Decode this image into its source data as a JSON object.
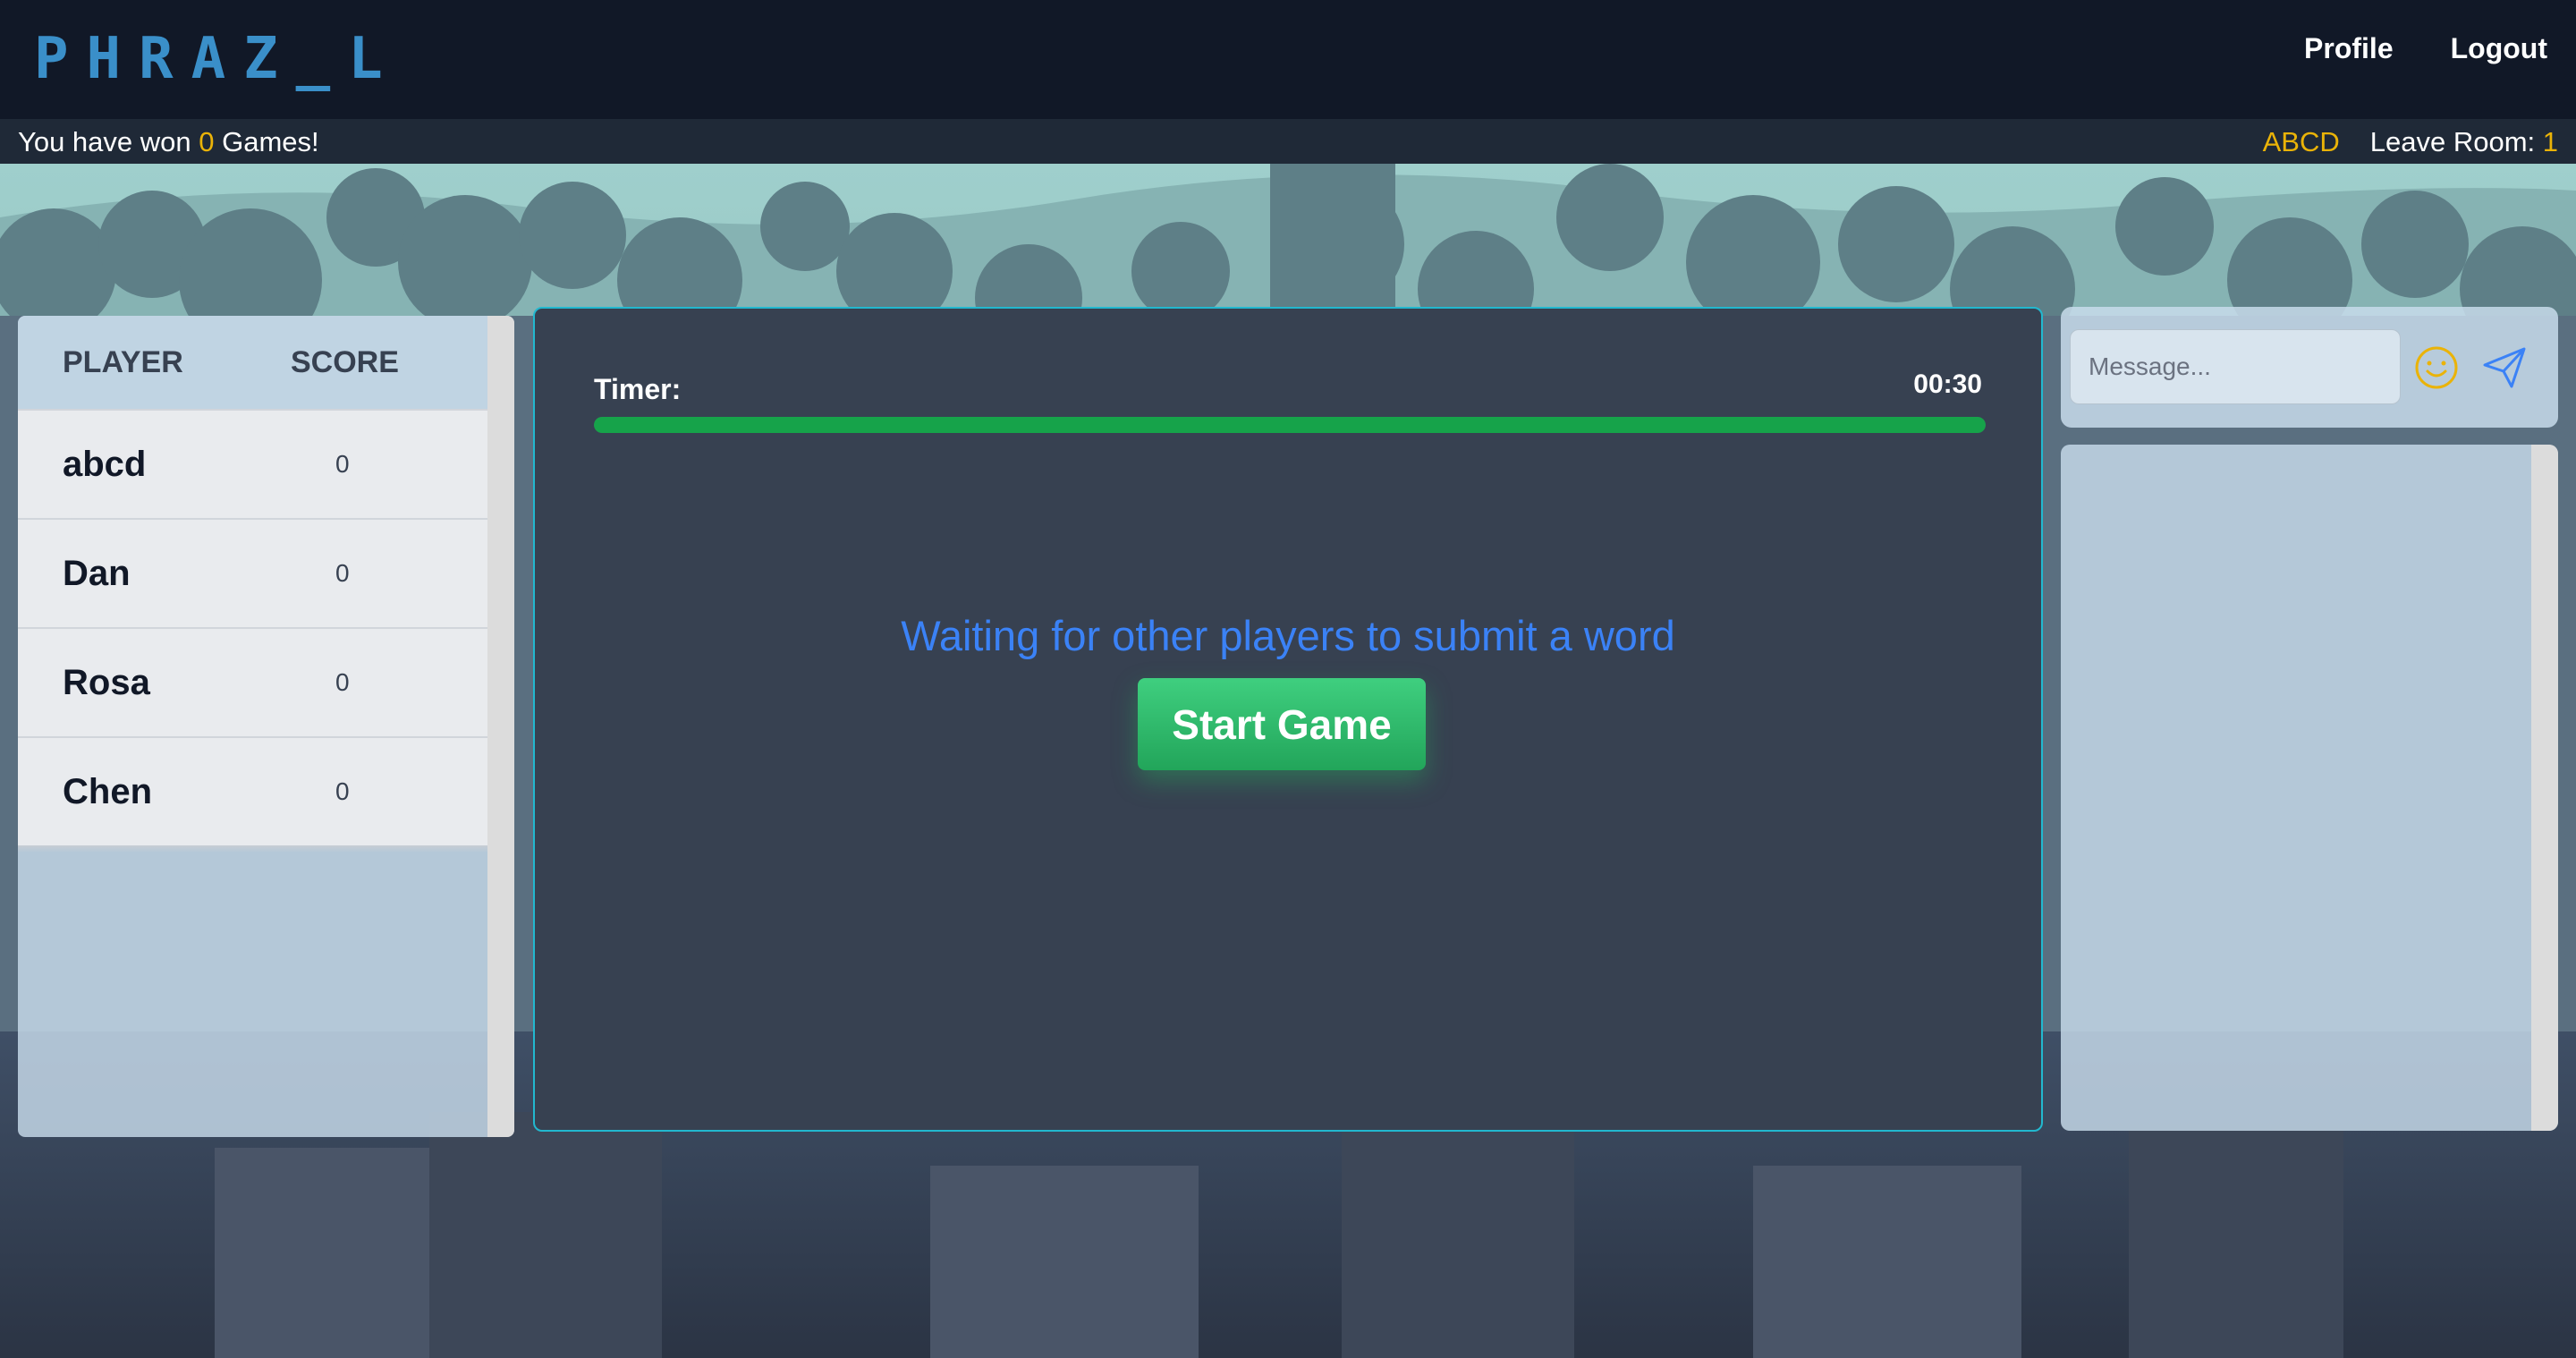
{
  "header": {
    "logo": "PHRAZ_L",
    "nav": {
      "profile": "Profile",
      "logout": "Logout"
    }
  },
  "status": {
    "won_prefix": "You have won ",
    "won_count": "0",
    "won_suffix": " Games!",
    "room_code": "ABCD",
    "leave_label": "Leave Room: ",
    "leave_count": "1"
  },
  "players": {
    "headers": {
      "player": "PLAYER",
      "score": "SCORE"
    },
    "rows": [
      {
        "name": "abcd",
        "score": "0"
      },
      {
        "name": "Dan",
        "score": "0"
      },
      {
        "name": "Rosa",
        "score": "0"
      },
      {
        "name": "Chen",
        "score": "0"
      }
    ]
  },
  "game": {
    "timer_label": "Timer:",
    "timer_value": "00:30",
    "timer_progress": 1.0,
    "waiting_text": "Waiting for other players to submit a word",
    "start_button": "Start Game"
  },
  "chat": {
    "placeholder": "Message...",
    "emoji_icon": "smiley-icon",
    "send_icon": "paper-plane-icon"
  },
  "colors": {
    "accent_gold": "#eab308",
    "timer_green": "#16a34a",
    "waiting_blue": "#3b82f6",
    "panel_border": "#22b8cf"
  }
}
